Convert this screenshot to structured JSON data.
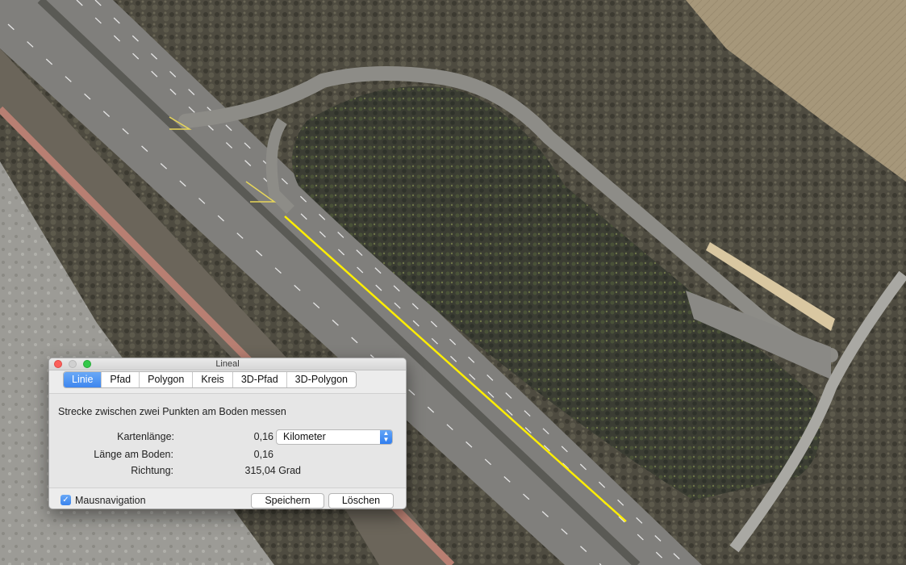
{
  "window": {
    "title": "Lineal"
  },
  "tabs": [
    {
      "label": "Linie",
      "active": true
    },
    {
      "label": "Pfad"
    },
    {
      "label": "Polygon"
    },
    {
      "label": "Kreis"
    },
    {
      "label": "3D-Pfad"
    },
    {
      "label": "3D-Polygon"
    }
  ],
  "panel": {
    "description": "Strecke zwischen zwei Punkten am Boden messen",
    "map_length_label": "Kartenlänge:",
    "map_length_value": "0,16",
    "unit_selected": "Kilometer",
    "ground_length_label": "Länge am Boden:",
    "ground_length_value": "0,16",
    "heading_label": "Richtung:",
    "heading_value": "315,04 Grad"
  },
  "footer": {
    "mouse_nav_label": "Mausnavigation",
    "mouse_nav_checked": true,
    "save_label": "Speichern",
    "delete_label": "Löschen"
  },
  "map": {
    "measure_line_color": "#ffee00"
  }
}
